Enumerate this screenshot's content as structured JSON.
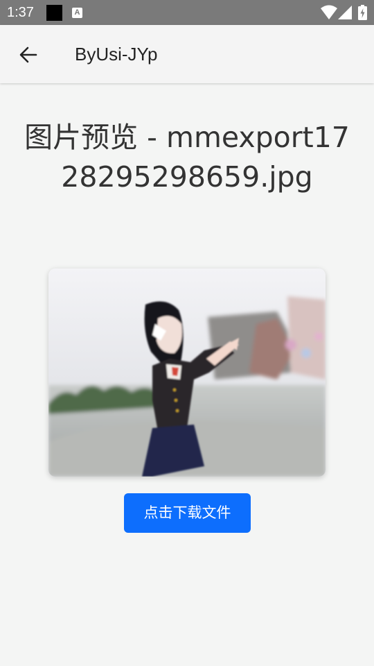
{
  "status_bar": {
    "time": "1:37",
    "notification_glyph": "A",
    "icons": [
      "wifi-icon",
      "cellular-signal-icon",
      "battery-charging-icon"
    ]
  },
  "app_bar": {
    "title": "ByUsi-JYp",
    "back_icon": "arrow-left-icon"
  },
  "main": {
    "title": "图片预览 - mmexport1728295298659.jpg",
    "image_alt": "mmexport1728295298659.jpg",
    "download_label": "点击下载文件"
  },
  "colors": {
    "status_bar": "#7a7a7a",
    "background": "#f4f5f4",
    "button": "#0d6efd"
  }
}
